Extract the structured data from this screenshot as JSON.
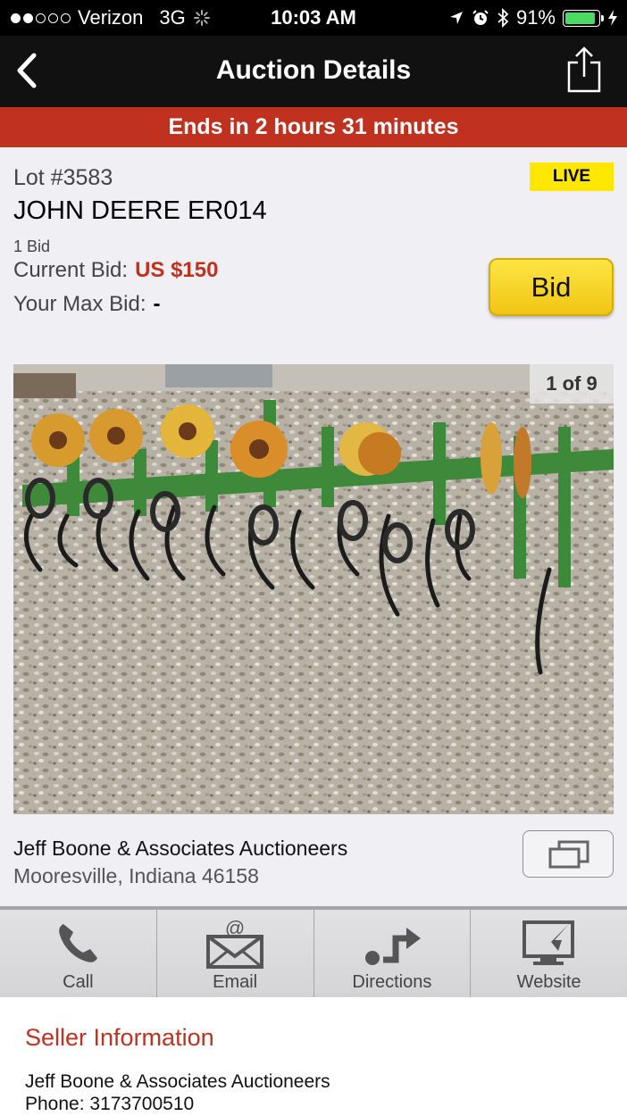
{
  "status_bar": {
    "carrier": "Verizon",
    "network": "3G",
    "time": "10:03 AM",
    "battery_percent": "91%",
    "battery_level": 0.91,
    "icons": [
      "location-arrow-icon",
      "alarm-icon",
      "bluetooth-icon",
      "charging-bolt-icon"
    ]
  },
  "nav": {
    "title": "Auction Details",
    "back_icon": "back-chevron-icon",
    "share_icon": "share-icon"
  },
  "banner": {
    "text": "Ends in 2 hours 31 minutes"
  },
  "lot": {
    "number": "Lot #3583",
    "title": "JOHN DEERE ER014",
    "badge": "LIVE",
    "bid_count": "1 Bid",
    "current_bid_label": "Current Bid:",
    "current_bid_value": "US $150",
    "max_bid_label": "Your Max Bid:",
    "max_bid_value": "-",
    "bid_button_label": "Bid"
  },
  "photo": {
    "counter": "1 of 9",
    "subject": "green farm cultivator with rotary hoe wheels on gravel"
  },
  "seller": {
    "name": "Jeff Boone & Associates Auctioneers",
    "location": "Mooresville, Indiana 46158",
    "gallery_icon": "photo-gallery-icon"
  },
  "actions": [
    {
      "label": "Call",
      "icon": "phone-icon"
    },
    {
      "label": "Email",
      "icon": "email-icon"
    },
    {
      "label": "Directions",
      "icon": "directions-icon"
    },
    {
      "label": "Website",
      "icon": "website-icon"
    }
  ],
  "seller_info": {
    "heading": "Seller Information",
    "name": "Jeff Boone & Associates Auctioneers",
    "phone": "Phone: 3173700510"
  },
  "colors": {
    "accent_red": "#c0311f",
    "live_yellow": "#ffe700",
    "bid_button_yellow": "#f7d52a",
    "battery_green": "#4cd964"
  }
}
